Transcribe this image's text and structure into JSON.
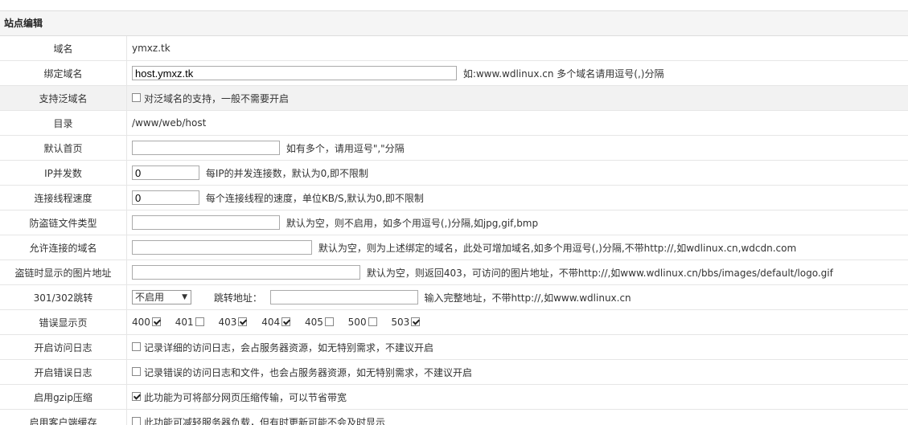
{
  "section_title": "站点编辑",
  "rows": {
    "domain": {
      "label": "域名",
      "value": "ymxz.tk"
    },
    "bind_domain": {
      "label": "绑定域名",
      "value": "host.ymxz.tk",
      "hint": "如:www.wdlinux.cn 多个域名请用逗号(,)分隔"
    },
    "wildcard": {
      "label": "支持泛域名",
      "checked": false,
      "hint": "对泛域名的支持，一般不需要开启"
    },
    "directory": {
      "label": "目录",
      "value": "/www/web/host"
    },
    "default_index": {
      "label": "默认首页",
      "value": "",
      "hint": "如有多个，请用逗号\",\"分隔"
    },
    "ip_concurrency": {
      "label": "IP并发数",
      "value": "0",
      "hint": "每IP的并发连接数，默认为0,即不限制"
    },
    "conn_speed": {
      "label": "连接线程速度",
      "value": "0",
      "hint": "每个连接线程的速度，单位KB/S,默认为0,即不限制"
    },
    "hotlink_types": {
      "label": "防盗链文件类型",
      "value": "",
      "hint": "默认为空，则不启用，如多个用逗号(,)分隔,如jpg,gif,bmp"
    },
    "allowed_domains": {
      "label": "允许连接的域名",
      "value": "",
      "hint": "默认为空，则为上述绑定的域名，此处可增加域名,如多个用逗号(,)分隔,不带http://,如wdlinux.cn,wdcdn.com"
    },
    "hotlink_image": {
      "label": "盗链时显示的图片地址",
      "value": "",
      "hint": "默认为空，则返回403，可访问的图片地址，不带http://,如www.wdlinux.cn/bbs/images/default/logo.gif"
    },
    "redirect": {
      "label": "301/302跳转",
      "select_value": "不启用",
      "redirect_label": "跳转地址：",
      "value": "",
      "hint": "输入完整地址，不带http://,如www.wdlinux.cn"
    },
    "error_pages": {
      "label": "错误显示页",
      "codes": [
        {
          "code": "400",
          "checked": true
        },
        {
          "code": "401",
          "checked": false
        },
        {
          "code": "403",
          "checked": true
        },
        {
          "code": "404",
          "checked": true
        },
        {
          "code": "405",
          "checked": false
        },
        {
          "code": "500",
          "checked": false
        },
        {
          "code": "503",
          "checked": true
        }
      ]
    },
    "access_log": {
      "label": "开启访问日志",
      "checked": false,
      "hint": "记录详细的访问日志，会占服务器资源，如无特别需求，不建议开启"
    },
    "error_log": {
      "label": "开启错误日志",
      "checked": false,
      "hint": "记录错误的访问日志和文件，也会占服务器资源，如无特别需求，不建议开启"
    },
    "gzip": {
      "label": "启用gzip压缩",
      "checked": true,
      "hint": "此功能为可将部分网页压缩传输，可以节省带宽"
    },
    "client_cache": {
      "label": "启用客户端缓存",
      "checked": false,
      "hint": "此功能可减轻服务器负载，但有时更新可能不会及时显示"
    }
  }
}
